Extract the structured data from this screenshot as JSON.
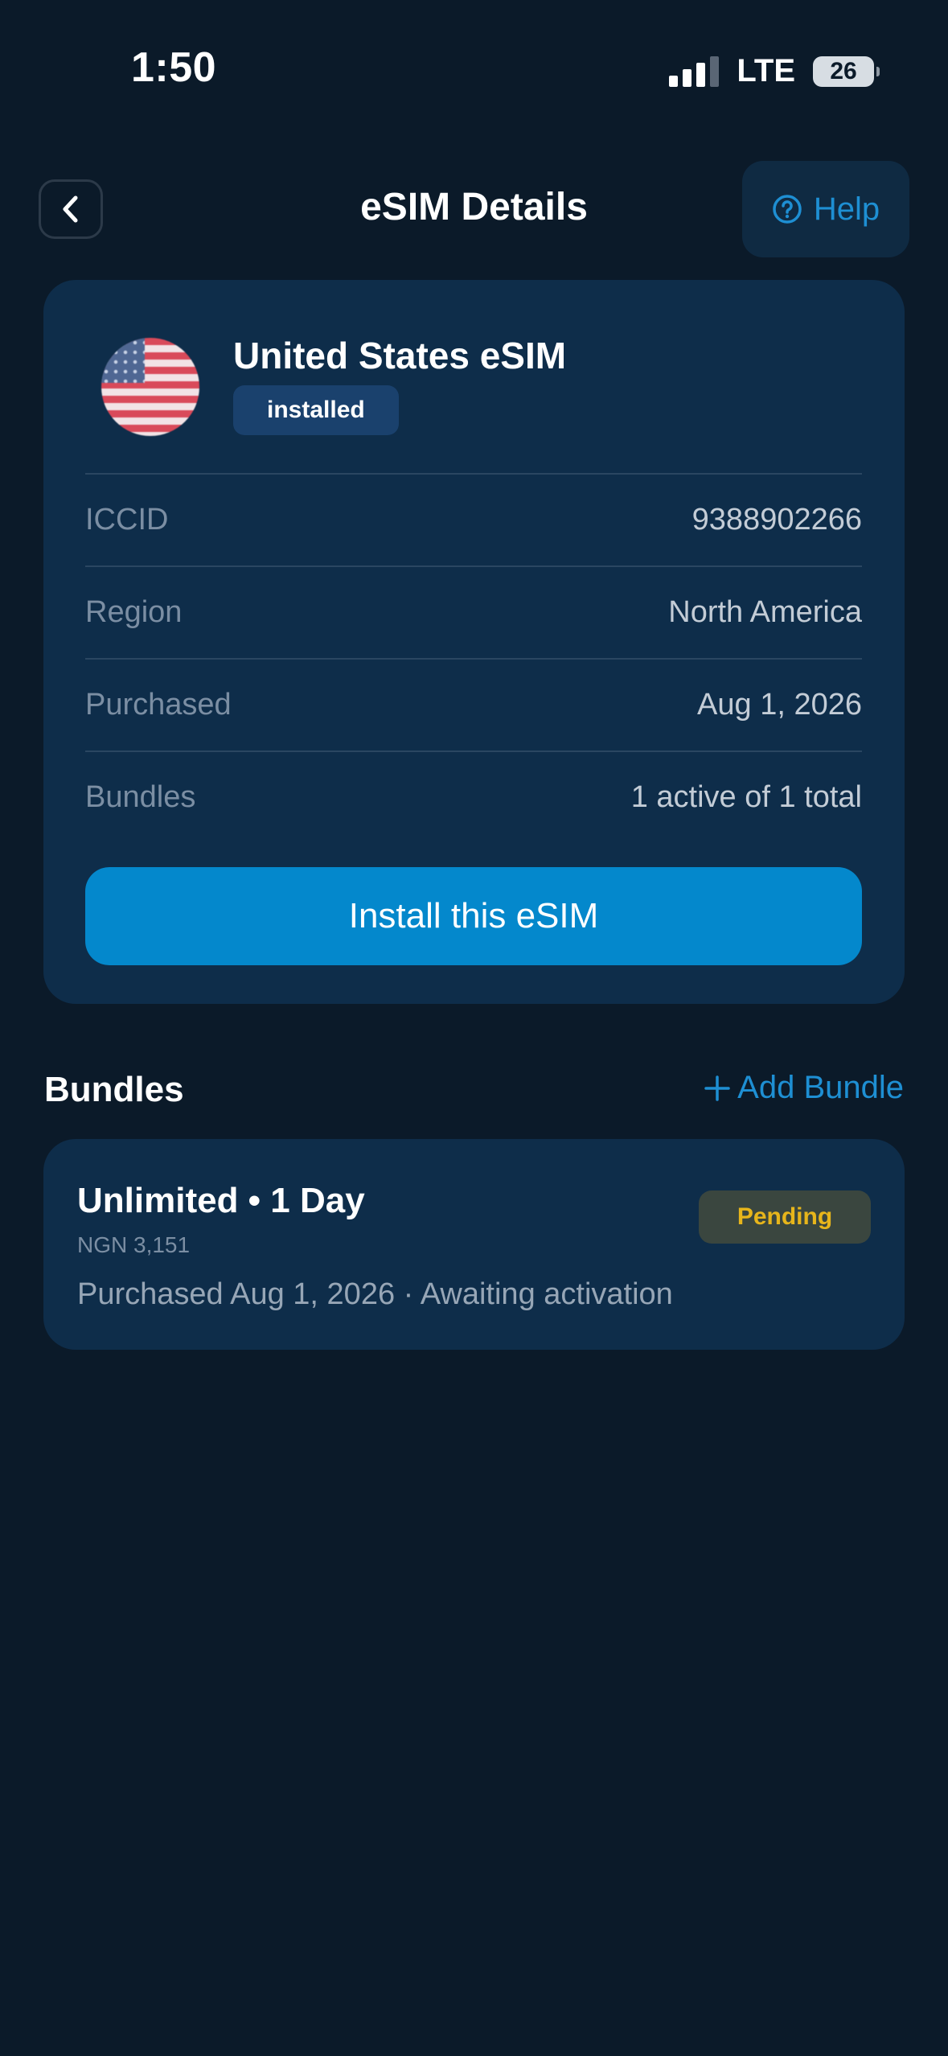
{
  "status_bar": {
    "time": "1:50",
    "network": "LTE",
    "battery": "26"
  },
  "header": {
    "title": "eSIM Details",
    "help_label": "Help",
    "icons": {
      "back": "chevron-left-icon",
      "help": "question-circle-icon"
    }
  },
  "esim": {
    "name": "United States eSIM",
    "status": "installed",
    "flag_icon": "us-flag-icon",
    "rows": [
      {
        "label": "ICCID",
        "value": "9388902266"
      },
      {
        "label": "Region",
        "value": "North America"
      },
      {
        "label": "Purchased",
        "value": "Aug 1, 2026"
      },
      {
        "label": "Bundles",
        "value": "1 active of 1 total"
      }
    ],
    "install_label": "Install this eSIM"
  },
  "bundles": {
    "title": "Bundles",
    "add_label": "Add Bundle",
    "items": [
      {
        "name": "Unlimited • 1 Day",
        "price": "NGN 3,151",
        "detail": "Purchased Aug 1, 2026 · Awaiting activation",
        "status": "Pending"
      }
    ]
  },
  "colors": {
    "background": "#0b1a29",
    "card": "#0e2d4a",
    "accent": "#0488cc",
    "link": "#1e8fd3",
    "pending": "#e7b51b"
  }
}
